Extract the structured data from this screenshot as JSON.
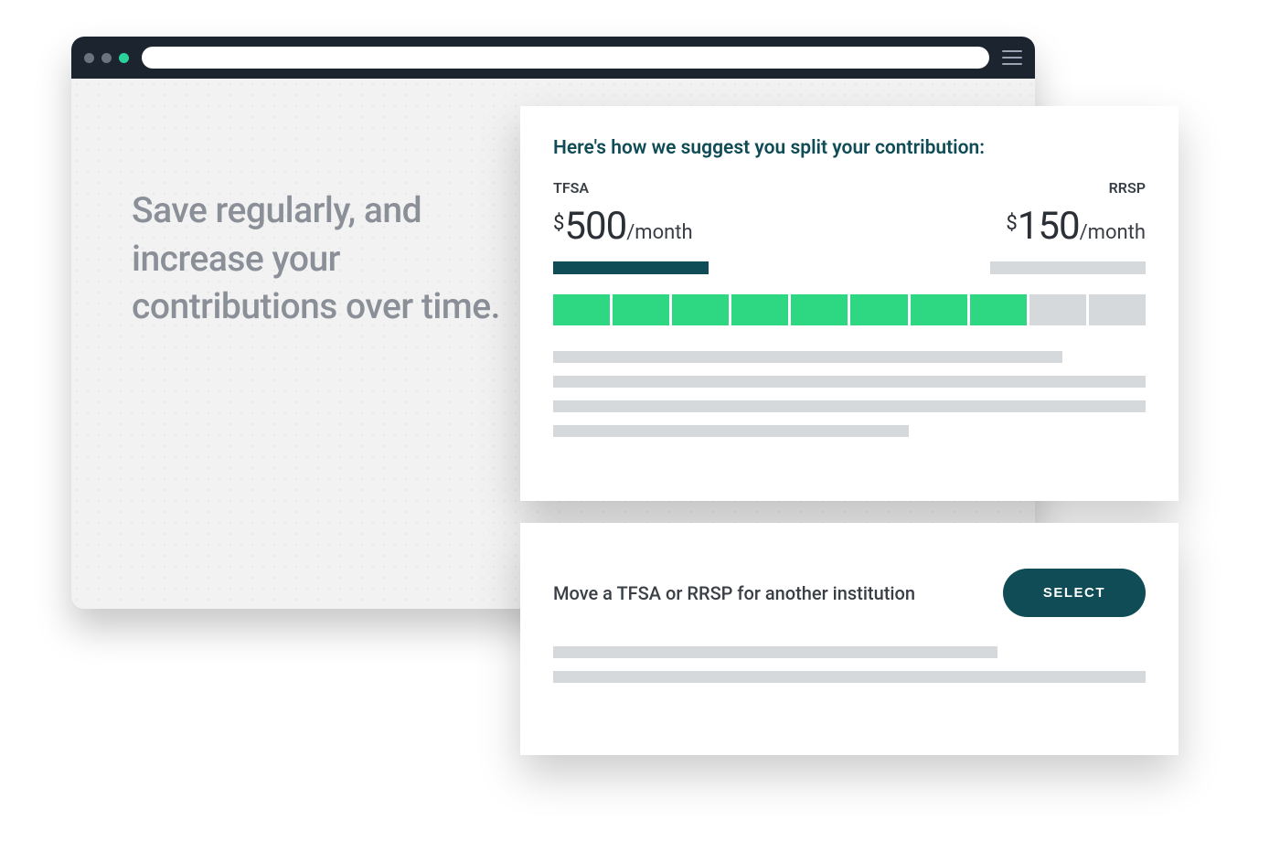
{
  "hero": {
    "text": "Save regularly, and increase your contributions over time."
  },
  "split_card": {
    "title": "Here's how we suggest you split your contribution:",
    "accounts": {
      "left": {
        "label": "TFSA",
        "currency": "$",
        "amount": "500",
        "period": "/month"
      },
      "right": {
        "label": "RRSP",
        "currency": "$",
        "amount": "150",
        "period": "/month"
      }
    },
    "segments_total": 10,
    "segments_on": 8
  },
  "move_card": {
    "text": "Move a TFSA or RRSP for another institution",
    "button_label": "SELECT"
  },
  "colors": {
    "brand_dark": "#0f4c56",
    "accent_green": "#2ed883",
    "placeholder_grey": "#d6d9db"
  }
}
